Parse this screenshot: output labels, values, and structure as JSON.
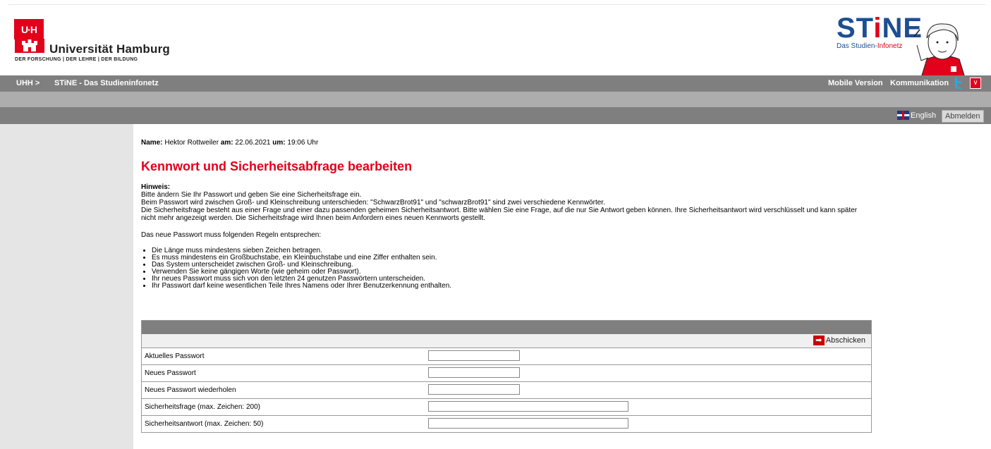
{
  "header": {
    "uhh_box_text": "U·H",
    "uhh_name": "Universität Hamburg",
    "uhh_subtitle": "DER FORSCHUNG | DER LEHRE | DER BILDUNG",
    "stine_title_a": "ST",
    "stine_title_i": "i",
    "stine_title_b": "NE",
    "stine_sub_a": "Das Studien-",
    "stine_sub_b": "Infonetz"
  },
  "nav": {
    "crumb1": "UHH >",
    "crumb2": "STiNE - Das Studieninfonetz",
    "mobile": "Mobile Version",
    "communication": "Kommunikation"
  },
  "subnav": {
    "language": "English",
    "logout": "Abmelden"
  },
  "user": {
    "name_label": "Name:",
    "name": "Hektor Rottweiler",
    "date_label": "am:",
    "date": "22.06.2021",
    "time_label": "um:",
    "time": "19:06 Uhr"
  },
  "page_title": "Kennwort und Sicherheitsabfrage bearbeiten",
  "hint": {
    "title": "Hinweis:",
    "line1": "Bitte ändern Sie Ihr Passwort und geben Sie eine Sicherheitsfrage ein.",
    "line2": "Beim Passwort wird zwischen Groß- und Kleinschreibung unterschieden: \"SchwarzBrot91\" und \"schwarzBrot91\" sind zwei verschiedene Kennwörter.",
    "line3": "Die Sicherheitsfrage besteht aus einer Frage und einer dazu passenden geheimen Sicherheitsantwort. Bitte wählen Sie eine Frage, auf die nur Sie Antwort geben können. Ihre Sicherheitsantwort wird verschlüsselt und kann später nicht mehr angezeigt werden. Die Sicherheitsfrage wird Ihnen beim Anfordern eines neuen Kennworts gestellt."
  },
  "rules_intro": "Das neue Passwort muss folgenden Regeln entsprechen:",
  "rules": [
    "Die Länge muss mindestens sieben Zeichen betragen.",
    "Es muss mindestens ein Großbuchstabe, ein Kleinbuchstabe und eine Ziffer enthalten sein.",
    "Das System unterscheidet zwischen Groß- und Kleinschreibung.",
    "Verwenden Sie keine gängigen Worte (wie geheim oder Passwort).",
    "Ihr neues Passwort muss sich von den letzten 24 genutzen Passwörtern unterscheiden.",
    "Ihr Passwort darf keine wesentlichen Teile Ihres Namens oder Ihrer Benutzerkennung enthalten."
  ],
  "form": {
    "submit_label": "Abschicken",
    "fields": [
      {
        "label": "Aktuelles Passwort",
        "value": ""
      },
      {
        "label": "Neues Passwort",
        "value": ""
      },
      {
        "label": "Neues Passwort wiederholen",
        "value": ""
      },
      {
        "label": "Sicherheitsfrage (max. Zeichen: 200)",
        "value": ""
      },
      {
        "label": "Sicherheitsantwort (max. Zeichen: 50)",
        "value": ""
      }
    ]
  },
  "colors": {
    "brand_red": "#e2001a",
    "nav_gray": "#7f7f7f",
    "stine_blue": "#1d4f91"
  }
}
